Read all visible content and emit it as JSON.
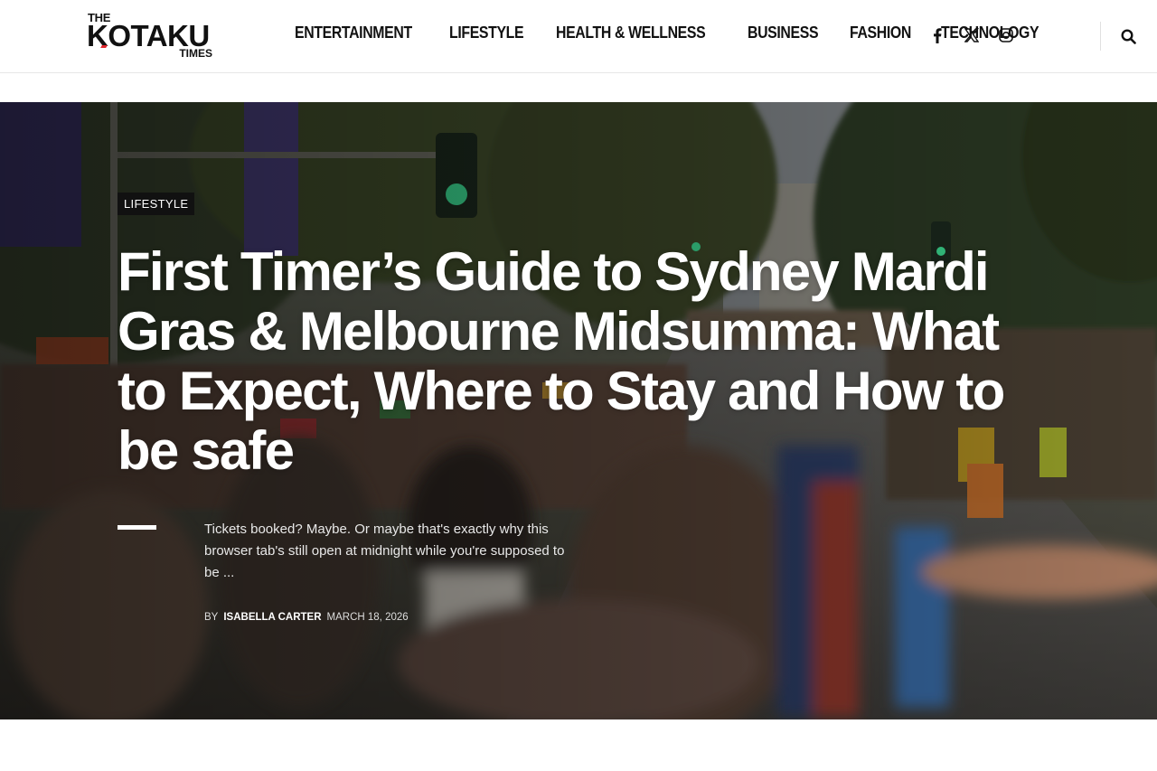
{
  "logo": {
    "the": "THE",
    "main": "KOTAKU",
    "times": "TIMES"
  },
  "nav": [
    {
      "label": "ENTERTAINMENT"
    },
    {
      "label": "LIFESTYLE"
    },
    {
      "label": "HEALTH & WELLNESS"
    },
    {
      "label": "BUSINESS"
    },
    {
      "label": "FASHION"
    },
    {
      "label": "TECHNOLOGY"
    }
  ],
  "socials": [
    "facebook-icon",
    "x-icon",
    "instagram-icon"
  ],
  "search_icon": "search-icon",
  "hero": {
    "category": "LIFESTYLE",
    "title": "First Timer’s Guide to Sydney Mardi Gras & Melbourne Midsumma: What to Expect, Where to Stay and How to be safe",
    "excerpt": "Tickets booked? Maybe. Or maybe that's exactly why this browser tab's still open at midnight while you're supposed to be ...",
    "by": "BY",
    "author": "ISABELLA CARTER",
    "date": "MARCH 18, 2026"
  },
  "colors": {
    "accent_red": "#e0242b",
    "badge_bg": "#111111",
    "text_dark": "#111111"
  }
}
